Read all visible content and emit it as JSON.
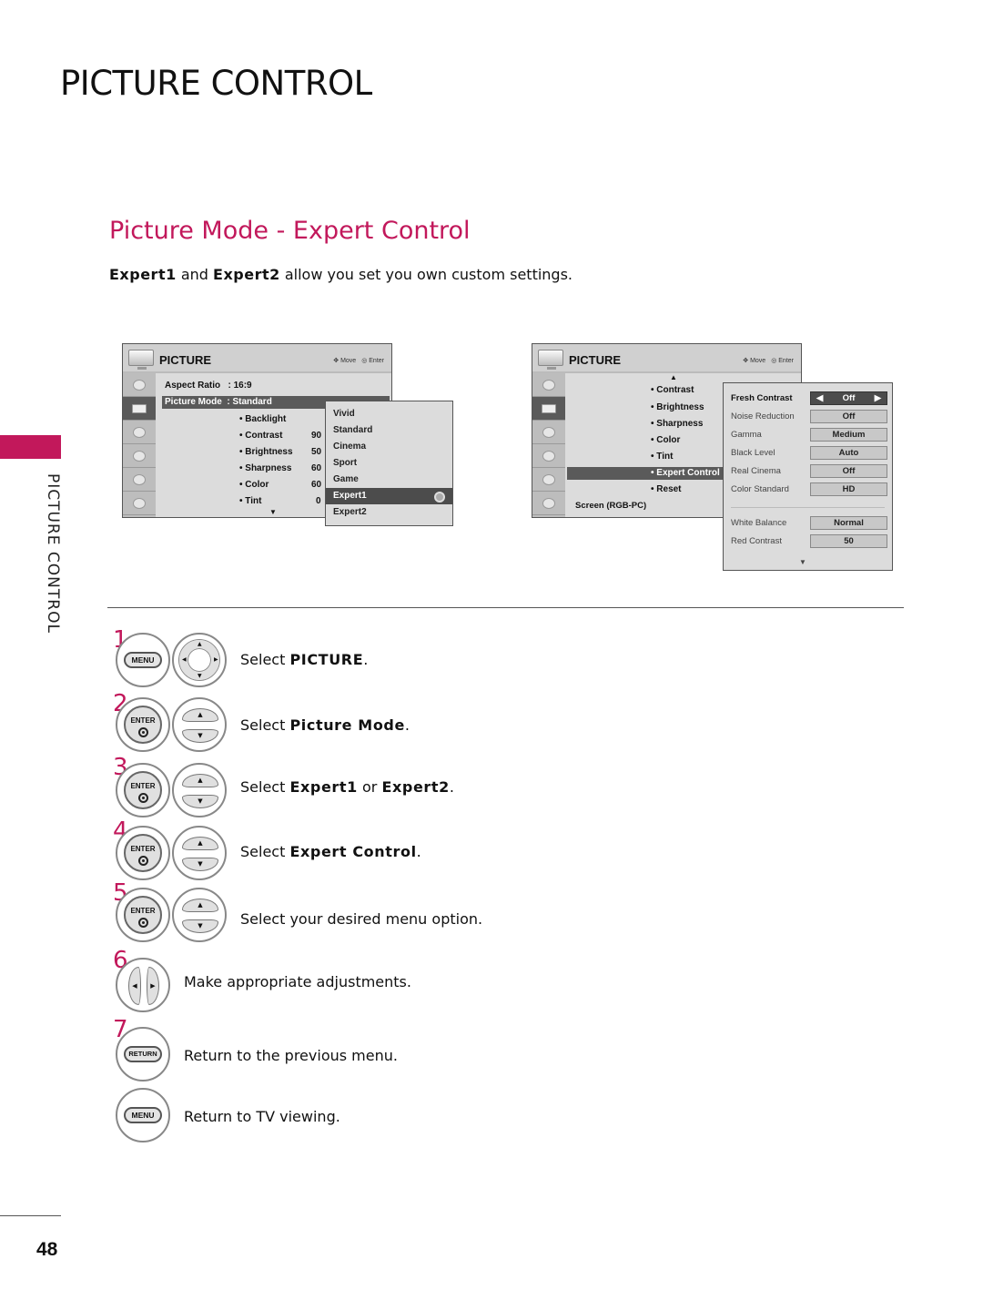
{
  "page": {
    "title": "PICTURE CONTROL",
    "section_title": "Picture Mode - Expert Control",
    "intro": {
      "bold1": "Expert1",
      "mid": " and ",
      "bold2": "Expert2",
      "rest": " allow you set you own custom settings."
    },
    "side_label": "PICTURE CONTROL",
    "page_number": "48",
    "accent_color": "#c2185b"
  },
  "osd_left": {
    "title": "PICTURE",
    "hint_move": "Move",
    "hint_enter": "Enter",
    "aspect_label": "Aspect Ratio",
    "aspect_value": ": 16:9",
    "mode_label": "Picture Mode",
    "mode_value": ": Standard",
    "items": [
      {
        "label": "• Backlight",
        "value": ""
      },
      {
        "label": "• Contrast",
        "value": "90"
      },
      {
        "label": "• Brightness",
        "value": "50"
      },
      {
        "label": "• Sharpness",
        "value": "60"
      },
      {
        "label": "• Color",
        "value": "60"
      },
      {
        "label": "• Tint",
        "value": "0"
      }
    ],
    "popup": [
      "Vivid",
      "Standard",
      "Cinema",
      "Sport",
      "Game",
      "Expert1",
      "Expert2"
    ],
    "popup_selected": "Expert1"
  },
  "osd_right": {
    "title": "PICTURE",
    "hint_move": "Move",
    "hint_enter": "Enter",
    "items": [
      "• Contrast",
      "• Brightness",
      "• Sharpness",
      "• Color",
      "• Tint",
      "• Expert Control",
      "• Reset"
    ],
    "highlighted": "• Expert Control",
    "screen_label": "Screen (RGB-PC)",
    "expert": [
      {
        "label": "Fresh Contrast",
        "value": "Off",
        "active": true
      },
      {
        "label": "Noise Reduction",
        "value": "Off"
      },
      {
        "label": "Gamma",
        "value": "Medium"
      },
      {
        "label": "Black Level",
        "value": "Auto"
      },
      {
        "label": "Real Cinema",
        "value": "Off"
      },
      {
        "label": "Color Standard",
        "value": "HD"
      },
      {
        "label": "White Balance",
        "value": "Normal"
      },
      {
        "label": "Red Contrast",
        "value": "50"
      }
    ]
  },
  "steps": [
    {
      "num": "1",
      "button": "MENU",
      "nav": "4-way",
      "pre": "Select ",
      "bold": "PICTURE",
      "post": "."
    },
    {
      "num": "2",
      "button": "ENTER",
      "nav": "up-down",
      "pre": "Select ",
      "bold": "Picture Mode",
      "post": "."
    },
    {
      "num": "3",
      "button": "ENTER",
      "nav": "up-down",
      "pre": "Select ",
      "bold": "Expert1",
      "mid": " or ",
      "bold2": "Expert2",
      "post": "."
    },
    {
      "num": "4",
      "button": "ENTER",
      "nav": "up-down",
      "pre": "Select ",
      "bold": "Expert Control",
      "post": "."
    },
    {
      "num": "5",
      "button": "ENTER",
      "nav": "up-down",
      "pre": "Select your desired menu option.",
      "bold": "",
      "post": ""
    },
    {
      "num": "6",
      "button": "",
      "nav": "left-right",
      "pre": "Make appropriate adjustments.",
      "bold": "",
      "post": ""
    },
    {
      "num": "7",
      "button": "RETURN",
      "nav": "",
      "pre": "Return to the previous menu.",
      "bold": "",
      "post": ""
    },
    {
      "num": "",
      "button": "MENU",
      "nav": "",
      "pre": "Return to TV viewing.",
      "bold": "",
      "post": ""
    }
  ]
}
